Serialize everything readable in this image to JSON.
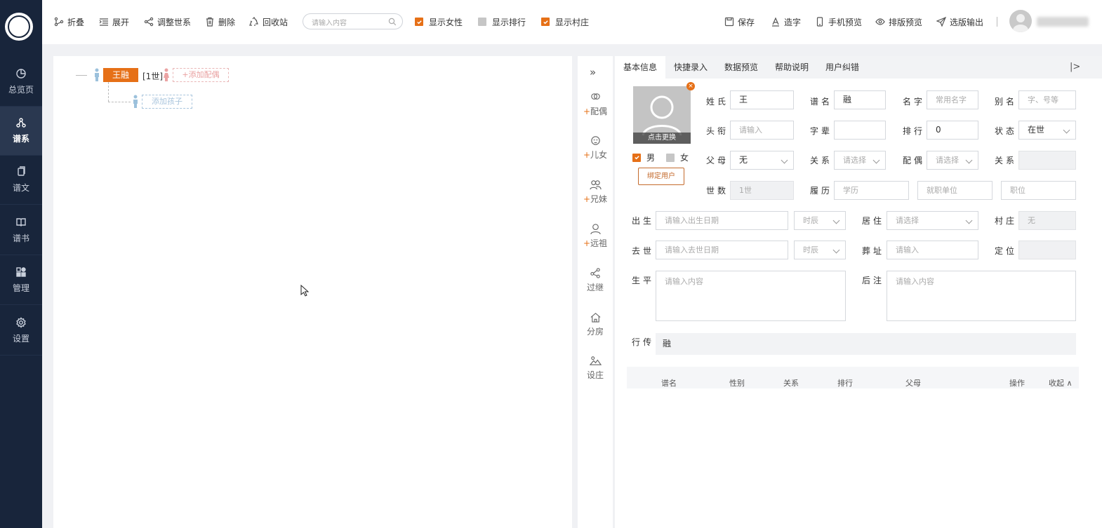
{
  "sidebar": {
    "items": [
      {
        "label": "总览页",
        "icon": "pie-chart-icon"
      },
      {
        "label": "谱系",
        "icon": "family-tree-icon",
        "active": true
      },
      {
        "label": "谱文",
        "icon": "document-icon"
      },
      {
        "label": "谱书",
        "icon": "book-icon"
      },
      {
        "label": "管理",
        "icon": "grid-icon"
      },
      {
        "label": "设置",
        "icon": "gear-icon"
      }
    ]
  },
  "toolbar": {
    "collapse": "折叠",
    "expand": "展开",
    "adjust": "调整世系",
    "delete": "删除",
    "recycle": "回收站",
    "search_placeholder": "请输入内容",
    "show_female": "显示女性",
    "show_rank": "显示排行",
    "show_village": "显示村庄",
    "save": "保存",
    "create_char": "造字",
    "mobile_preview": "手机预览",
    "layout_preview": "排版预览",
    "output": "选版输出"
  },
  "tree": {
    "root_name": "王融",
    "generation": "[1世]",
    "add_spouse": "+添加配偶",
    "add_child": "添加孩子"
  },
  "side_actions": [
    {
      "plus": "+",
      "label": "配偶",
      "icon": "spouse-icon"
    },
    {
      "plus": "+",
      "label": "儿女",
      "icon": "child-icon"
    },
    {
      "plus": "+",
      "label": "兄妹",
      "icon": "siblings-icon"
    },
    {
      "plus": "+",
      "label": "远祖",
      "icon": "ancestor-icon"
    },
    {
      "plus": "",
      "label": "过继",
      "icon": "adopt-icon"
    },
    {
      "plus": "",
      "label": "分房",
      "icon": "house-icon"
    },
    {
      "plus": "",
      "label": "设庄",
      "icon": "village-icon"
    }
  ],
  "tabs": [
    "基本信息",
    "快捷录入",
    "数据预览",
    "帮助说明",
    "用户纠错"
  ],
  "form": {
    "photo_change": "点击更换",
    "male": "男",
    "female": "女",
    "bind_user": "绑定用户",
    "surname_label": "姓氏",
    "surname": "王",
    "pu_name_label": "谱名",
    "pu_name": "融",
    "given_name_label": "名字",
    "given_name_ph": "常用名字",
    "alias_label": "别名",
    "alias_ph": "字、号等",
    "title_label": "头衔",
    "title_ph": "请输入",
    "zibei_label": "字辈",
    "rank_label": "排行",
    "rank": "0",
    "status_label": "状态",
    "status": "在世",
    "parents_label": "父母",
    "parents": "无",
    "relation_label": "关系",
    "relation_ph": "请选择",
    "spouse_label": "配偶",
    "spouse_ph": "请选择",
    "relation2_label": "关系",
    "gen_label": "世数",
    "gen": "1世",
    "resume_label": "履历",
    "edu_ph": "学历",
    "employer_ph": "就职单位",
    "position_ph": "职位",
    "birth_label": "出生",
    "birth_ph": "请输入出生日期",
    "shichen_ph": "时辰",
    "residence_label": "居住",
    "residence_ph": "请选择",
    "village_label": "村庄",
    "village": "无",
    "death_label": "去世",
    "death_ph": "请输入去世日期",
    "burial_label": "葬址",
    "burial_ph": "请输入",
    "locate_label": "定位",
    "bio_label": "生平",
    "bio_ph": "请输入内容",
    "note_label": "后注",
    "note_ph": "请输入内容",
    "xingzhuan_label": "行传",
    "xingzhuan": "融"
  },
  "relatives_table": {
    "columns": [
      "谱名",
      "性别",
      "关系",
      "排行",
      "父母",
      "操作"
    ],
    "collapse": "收起"
  },
  "colors": {
    "accent": "#e67017",
    "sidebar": "#18253b"
  }
}
